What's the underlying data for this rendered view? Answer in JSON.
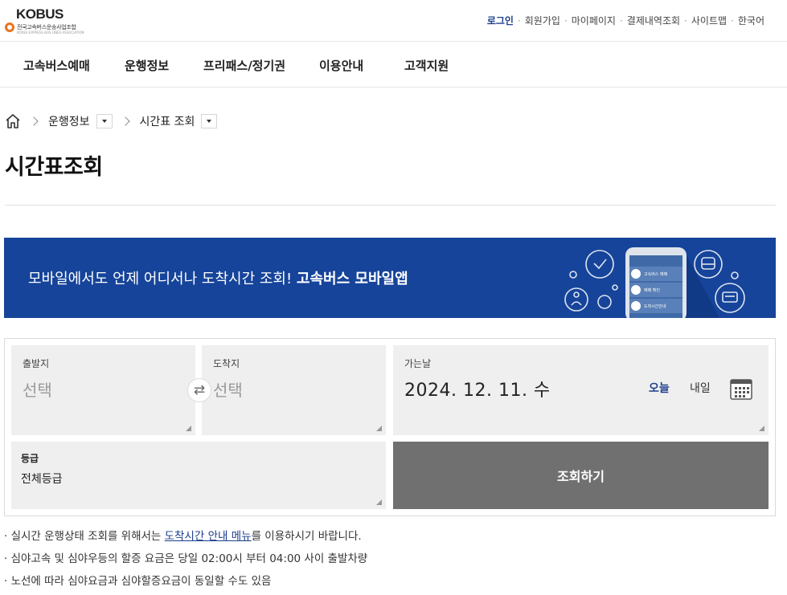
{
  "header": {
    "logo": {
      "name": "KOBUS",
      "subtitle": "전국고속버스운송사업조합",
      "subtitle_en": "KOREA EXPRESS BUS LINES ASSOCIATION"
    },
    "util_links": [
      "로그인",
      "회원가입",
      "마이페이지",
      "결제내역조회",
      "사이트맵",
      "한국어"
    ]
  },
  "gnb": [
    "고속버스예매",
    "운행정보",
    "프리패스/정기권",
    "이용안내",
    "고객지원"
  ],
  "breadcrumb": {
    "level1": "운행정보",
    "level2": "시간표 조회"
  },
  "page_title": "시간표조회",
  "banner": {
    "text": "모바일에서도 언제 어디서나 도착시간 조회!",
    "bold": "고속버스 모바일앱",
    "phone_items": [
      "고속버스 예매",
      "예매 확인",
      "도착시간안내"
    ],
    "bg_color": "#16449a"
  },
  "form": {
    "departure": {
      "label": "출발지",
      "placeholder": "선택"
    },
    "arrival": {
      "label": "도착지",
      "placeholder": "선택"
    },
    "date": {
      "label": "가는날",
      "value": "2024. 12. 11. 수",
      "today": "오늘",
      "tomorrow": "내일"
    },
    "grade": {
      "label": "등급",
      "value": "전체등급"
    },
    "submit": "조회하기"
  },
  "notes": {
    "n1_pre": "· 실시간 운행상태 조회를 위해서는 ",
    "n1_link": "도착시간 안내 메뉴",
    "n1_post": "를 이용하시기 바랍니다.",
    "n2": "· 심야고속 및 심야우등의 할증 요금은 당일 02:00시 부터 04:00 사이 출발차량",
    "n3": "· 노선에 따라 심야요금과 심야할증요금이 동일할 수도 있음"
  }
}
